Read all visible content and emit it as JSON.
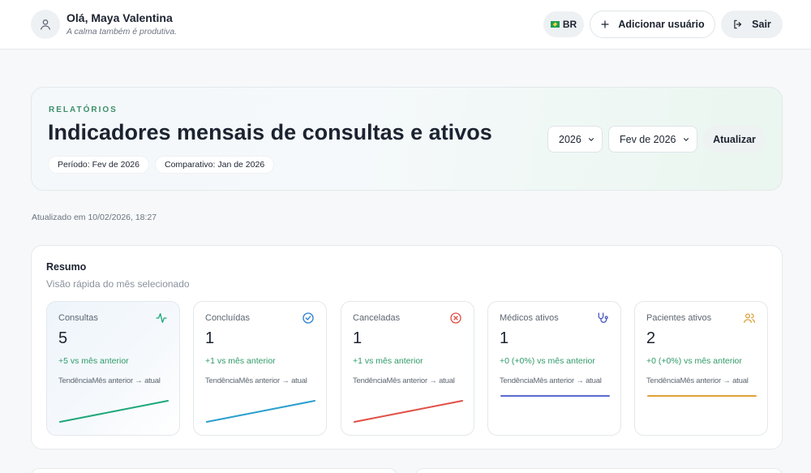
{
  "header": {
    "greeting": "Olá, Maya Valentina",
    "tagline": "A calma também é produtiva.",
    "locale_label": "BR",
    "add_user_label": "Adicionar usuário",
    "exit_label": "Sair"
  },
  "hero": {
    "eyebrow": "RELATÓRIOS",
    "title": "Indicadores mensais de consultas e ativos",
    "period_chip": "Período: Fev de 2026",
    "compare_chip": "Comparativo: Jan de 2026",
    "year_select": "2026",
    "month_select": "Fev de 2026",
    "update_label": "Atualizar"
  },
  "updated_text": "Atualizado em 10/02/2026, 18:27",
  "summary": {
    "title": "Resumo",
    "subtitle": "Visão rápida do mês selecionado",
    "trend_label": "Tendência",
    "trend_range": "Mês anterior → atual",
    "cards": [
      {
        "label": "Consultas",
        "value": "5",
        "delta": "+5 vs mês anterior",
        "icon": "activity-icon",
        "color": "#1fa87a",
        "prev": 0,
        "curr": 5
      },
      {
        "label": "Concluídas",
        "value": "1",
        "delta": "+1 vs mês anterior",
        "icon": "check-circle-icon",
        "color": "#2a9fce",
        "prev": 0,
        "curr": 1
      },
      {
        "label": "Canceladas",
        "value": "1",
        "delta": "+1 vs mês anterior",
        "icon": "x-circle-icon",
        "color": "#e05047",
        "prev": 0,
        "curr": 1
      },
      {
        "label": "Médicos ativos",
        "value": "1",
        "delta": "+0 (+0%) vs mês anterior",
        "icon": "stethoscope-icon",
        "color": "#5a6ad0",
        "prev": 1,
        "curr": 1
      },
      {
        "label": "Pacientes ativos",
        "value": "2",
        "delta": "+0 (+0%) vs mês anterior",
        "icon": "users-icon",
        "color": "#e0a13a",
        "prev": 2,
        "curr": 2
      }
    ]
  }
}
